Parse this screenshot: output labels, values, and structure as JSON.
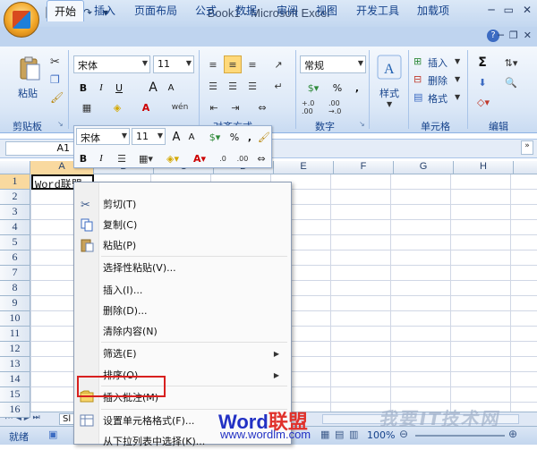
{
  "window": {
    "title": "Book1 - Microsoft Excel"
  },
  "qat": {
    "save": "💾",
    "undo": "↶",
    "redo": "↷",
    "more": "▾"
  },
  "tabs": [
    "开始",
    "插入",
    "页面布局",
    "公式",
    "数据",
    "审阅",
    "视图",
    "开发工具",
    "加载项"
  ],
  "ribbon": {
    "clipboard": {
      "paste": "粘贴",
      "label": "剪贴板"
    },
    "font": {
      "name": "宋体",
      "size": "11",
      "bold": "B",
      "italic": "I",
      "underline": "U",
      "grow": "A",
      "shrink": "A",
      "phonetic": "wén"
    },
    "alignment": {
      "label": "对齐方式"
    },
    "number": {
      "format": "常规",
      "percent": "%",
      "comma": ",",
      "label": "数字",
      "inc": "+.0 .00",
      "dec": ".00 →.0"
    },
    "styles": {
      "label": "样式"
    },
    "cells": {
      "insert": "插入",
      "delete": "删除",
      "format": "格式",
      "label": "单元格"
    },
    "editing": {
      "sum": "Σ",
      "label": "编辑"
    }
  },
  "formula_bar": {
    "namebox": "A1",
    "expand": "»"
  },
  "columns": [
    "A",
    "B",
    "C",
    "D",
    "E",
    "F",
    "G",
    "H"
  ],
  "rows": [
    "1",
    "2",
    "3",
    "4",
    "5",
    "6",
    "7",
    "8",
    "9",
    "10",
    "11",
    "12",
    "13",
    "14",
    "15",
    "16"
  ],
  "cell_a1": "Word联盟",
  "mini_toolbar": {
    "font": "宋体",
    "size": "11",
    "bold": "B",
    "italic": "I",
    "percent": "%",
    "comma": ","
  },
  "context_menu": [
    {
      "label": "剪切(T)",
      "icon": "scissors-icon",
      "submenu": false
    },
    {
      "label": "复制(C)",
      "icon": "copy-icon",
      "submenu": false
    },
    {
      "label": "粘贴(P)",
      "icon": "paste-icon",
      "submenu": false
    },
    {
      "label": "选择性粘贴(V)...",
      "icon": "",
      "submenu": false
    },
    {
      "label": "插入(I)...",
      "icon": "",
      "submenu": false
    },
    {
      "label": "删除(D)...",
      "icon": "",
      "submenu": false
    },
    {
      "label": "清除内容(N)",
      "icon": "",
      "submenu": false
    },
    {
      "label": "筛选(E)",
      "icon": "",
      "submenu": true
    },
    {
      "label": "排序(O)",
      "icon": "",
      "submenu": true
    },
    {
      "label": "插入批注(M)",
      "icon": "comment-icon",
      "submenu": false
    },
    {
      "label": "设置单元格格式(F)...",
      "icon": "format-cells-icon",
      "submenu": false
    },
    {
      "label": "从下拉列表中选择(K)...",
      "icon": "",
      "submenu": false
    }
  ],
  "sheet_tab": "Sl",
  "status": {
    "ready": "就绪",
    "zoom": "100%"
  },
  "watermark": {
    "brand_word": "Word",
    "brand_cn": "联盟",
    "url": "www.wordlm.com",
    "right": "我要IT技术网"
  },
  "colors": {
    "highlight": "#d8201f",
    "ribbon": "#dce8f7",
    "brand_blue": "#2231c4",
    "brand_red": "#e0312b"
  }
}
